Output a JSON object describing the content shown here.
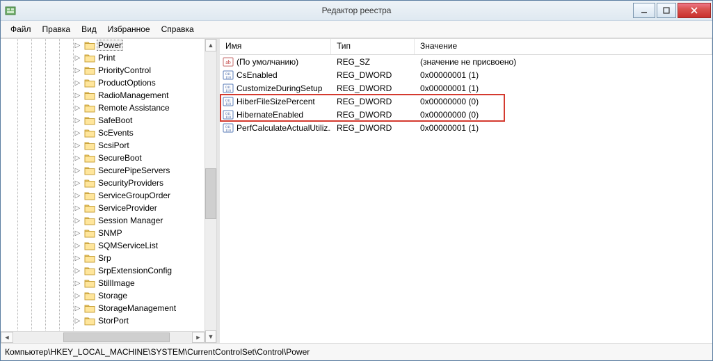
{
  "window": {
    "title": "Редактор реестра"
  },
  "menus": {
    "file": "Файл",
    "edit": "Правка",
    "view": "Вид",
    "favorites": "Избранное",
    "help": "Справка"
  },
  "columns": {
    "name": "Имя",
    "type": "Тип",
    "value": "Значение"
  },
  "tree": {
    "selected": "Power",
    "items": [
      {
        "label": "Power",
        "selected": true
      },
      {
        "label": "Print"
      },
      {
        "label": "PriorityControl"
      },
      {
        "label": "ProductOptions"
      },
      {
        "label": "RadioManagement"
      },
      {
        "label": "Remote Assistance"
      },
      {
        "label": "SafeBoot"
      },
      {
        "label": "ScEvents"
      },
      {
        "label": "ScsiPort"
      },
      {
        "label": "SecureBoot"
      },
      {
        "label": "SecurePipeServers"
      },
      {
        "label": "SecurityProviders"
      },
      {
        "label": "ServiceGroupOrder"
      },
      {
        "label": "ServiceProvider"
      },
      {
        "label": "Session Manager"
      },
      {
        "label": "SNMP"
      },
      {
        "label": "SQMServiceList"
      },
      {
        "label": "Srp"
      },
      {
        "label": "SrpExtensionConfig"
      },
      {
        "label": "StillImage"
      },
      {
        "label": "Storage"
      },
      {
        "label": "StorageManagement"
      },
      {
        "label": "StorPort"
      }
    ]
  },
  "values": [
    {
      "icon": "string",
      "name": "(По умолчанию)",
      "type": "REG_SZ",
      "value": "(значение не присвоено)"
    },
    {
      "icon": "binary",
      "name": "CsEnabled",
      "type": "REG_DWORD",
      "value": "0x00000001 (1)"
    },
    {
      "icon": "binary",
      "name": "CustomizeDuringSetup",
      "type": "REG_DWORD",
      "value": "0x00000001 (1)"
    },
    {
      "icon": "binary",
      "name": "HiberFileSizePercent",
      "type": "REG_DWORD",
      "value": "0x00000000 (0)",
      "hl": true
    },
    {
      "icon": "binary",
      "name": "HibernateEnabled",
      "type": "REG_DWORD",
      "value": "0x00000000 (0)",
      "hl": true
    },
    {
      "icon": "binary",
      "name": "PerfCalculateActualUtiliz...",
      "type": "REG_DWORD",
      "value": "0x00000001 (1)"
    }
  ],
  "statusbar": {
    "path": "Компьютер\\HKEY_LOCAL_MACHINE\\SYSTEM\\CurrentControlSet\\Control\\Power"
  }
}
